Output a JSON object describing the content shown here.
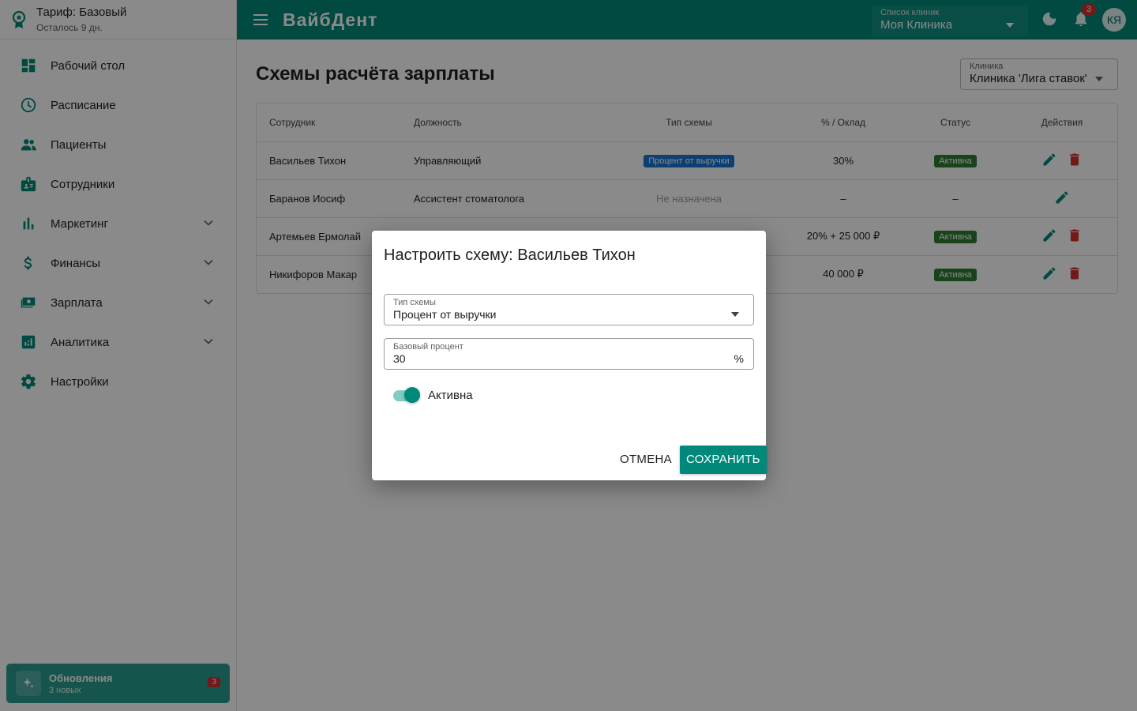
{
  "app": {
    "brand": "ВайбДент",
    "plan_title": "Тариф: Базовый",
    "plan_sub": "Осталось 9 дн."
  },
  "topbar": {
    "clinic_list_label": "Список клиник",
    "clinic_list_value": "Моя Клиника",
    "notifications_count": "3",
    "avatar_initials": "КЯ"
  },
  "sidebar": {
    "items": [
      {
        "label": "Рабочий стол",
        "icon": "dashboard-icon"
      },
      {
        "label": "Расписание",
        "icon": "clock-icon"
      },
      {
        "label": "Пациенты",
        "icon": "people-icon"
      },
      {
        "label": "Сотрудники",
        "icon": "badge-icon"
      },
      {
        "label": "Маркетинг",
        "icon": "bar-chart-icon",
        "expandable": true
      },
      {
        "label": "Финансы",
        "icon": "dollar-icon",
        "expandable": true
      },
      {
        "label": "Зарплата",
        "icon": "cash-icon",
        "expandable": true
      },
      {
        "label": "Аналитика",
        "icon": "analytics-icon",
        "expandable": true
      },
      {
        "label": "Настройки",
        "icon": "gear-icon"
      }
    ],
    "updates": {
      "title": "Обновления",
      "sub": "3 новых",
      "count": "3"
    }
  },
  "page": {
    "title": "Схемы расчёта зарплаты",
    "clinic_filter_label": "Клиника",
    "clinic_filter_value": "Клиника 'Лига ставок'"
  },
  "table": {
    "headers": [
      "Сотрудник",
      "Должность",
      "Тип схемы",
      "% / Оклад",
      "Статус",
      "Действия"
    ],
    "rows": [
      {
        "employee": "Васильев Тихон",
        "position": "Управляющий",
        "scheme": "Процент от выручки",
        "amount": "30%",
        "status": "Активна"
      },
      {
        "employee": "Баранов Иосиф",
        "position": "Ассистент стоматолога",
        "scheme": "Не назначена",
        "amount": "–",
        "status": "–"
      },
      {
        "employee": "Артемьев Ермолай",
        "position": "",
        "scheme": "",
        "amount": "20% + 25 000 ₽",
        "status": "Активна"
      },
      {
        "employee": "Никифоров Макар",
        "position": "",
        "scheme": "",
        "amount": "40 000 ₽",
        "status": "Активна"
      }
    ]
  },
  "dialog": {
    "title": "Настроить схему: Васильев Тихон",
    "scheme_label": "Тип схемы",
    "scheme_value": "Процент от выручки",
    "percent_label": "Базовый процент",
    "percent_value": "30",
    "percent_suffix": "%",
    "active_label": "Активна",
    "active_on": true,
    "cancel_label": "Отмена",
    "save_label": "Сохранить"
  },
  "colors": {
    "primary": "#00897b",
    "chip_percent": "#1976d2",
    "chip_mixed": "#8e24aa",
    "chip_active": "#2e7d32",
    "delete": "#d32f2f"
  }
}
